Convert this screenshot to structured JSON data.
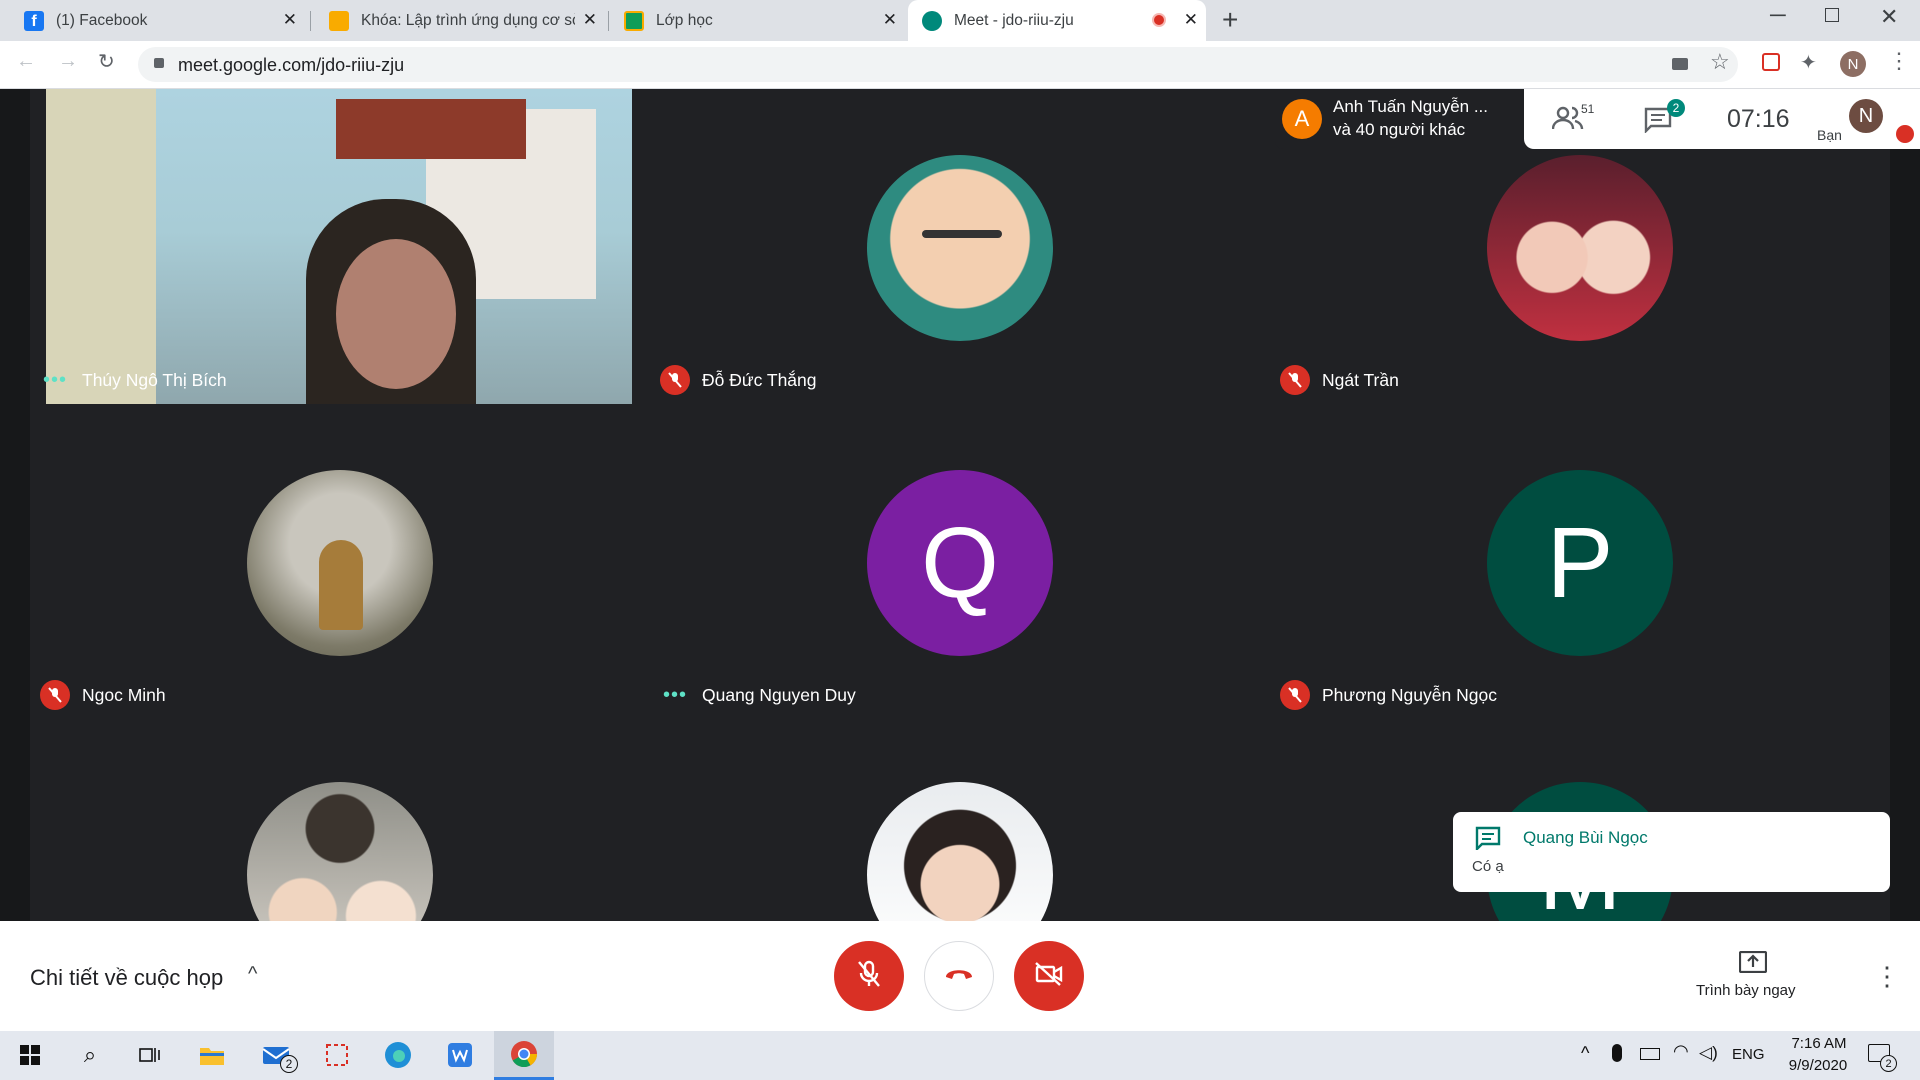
{
  "browser": {
    "tabs": [
      {
        "title": "(1) Facebook",
        "icon": "facebook-icon",
        "color": "#1877f2"
      },
      {
        "title": "Khóa: Lập trình ứng dụng cơ sở d",
        "icon": "course-icon",
        "color": "#f9ab00"
      },
      {
        "title": "Lớp học",
        "icon": "classroom-icon",
        "color": "#0f9d58"
      },
      {
        "title": "Meet - jdo-riiu-zju",
        "icon": "meet-icon",
        "color": "#00897b"
      }
    ],
    "url": "meet.google.com/jdo-riiu-zju",
    "profile_initial": "N"
  },
  "meet": {
    "presenter": {
      "initial": "A",
      "line1": "Anh Tuấn Nguyễn ...",
      "line2": "và 40 người khác",
      "color": "#f57c00"
    },
    "participant_count": "51",
    "chat_badge": "2",
    "time": "07:16",
    "self_initial": "N",
    "self_label": "Bạn",
    "tiles": [
      {
        "name": "Thúy Ngô Thị Bích",
        "status": "speaking",
        "kind": "video"
      },
      {
        "name": "Đỗ Đức Thắng",
        "status": "muted",
        "kind": "photo"
      },
      {
        "name": "Ngát Trần",
        "status": "muted",
        "kind": "photo"
      },
      {
        "name": "Ngoc Minh",
        "status": "muted",
        "kind": "photo"
      },
      {
        "name": "Quang Nguyen Duy",
        "status": "speaking",
        "kind": "letter",
        "letter": "Q",
        "color": "#7b1fa2"
      },
      {
        "name": "Phương Nguyễn Ngọc",
        "status": "muted",
        "kind": "letter",
        "letter": "P",
        "color": "#004d40"
      },
      {
        "name": "",
        "status": "none",
        "kind": "photo"
      },
      {
        "name": "",
        "status": "none",
        "kind": "photo"
      },
      {
        "name": "",
        "status": "none",
        "kind": "letter",
        "letter": "M",
        "color": "#004d40"
      }
    ],
    "toast": {
      "sender": "Quang Bùi Ngọc",
      "message": "Có ạ"
    },
    "meeting_details": "Chi tiết về cuộc họp",
    "present_label": "Trình bày ngay"
  },
  "taskbar": {
    "mail_badge": "2",
    "lang": "ENG",
    "time": "7:16 AM",
    "date": "9/9/2020",
    "notif_badge": "2"
  }
}
